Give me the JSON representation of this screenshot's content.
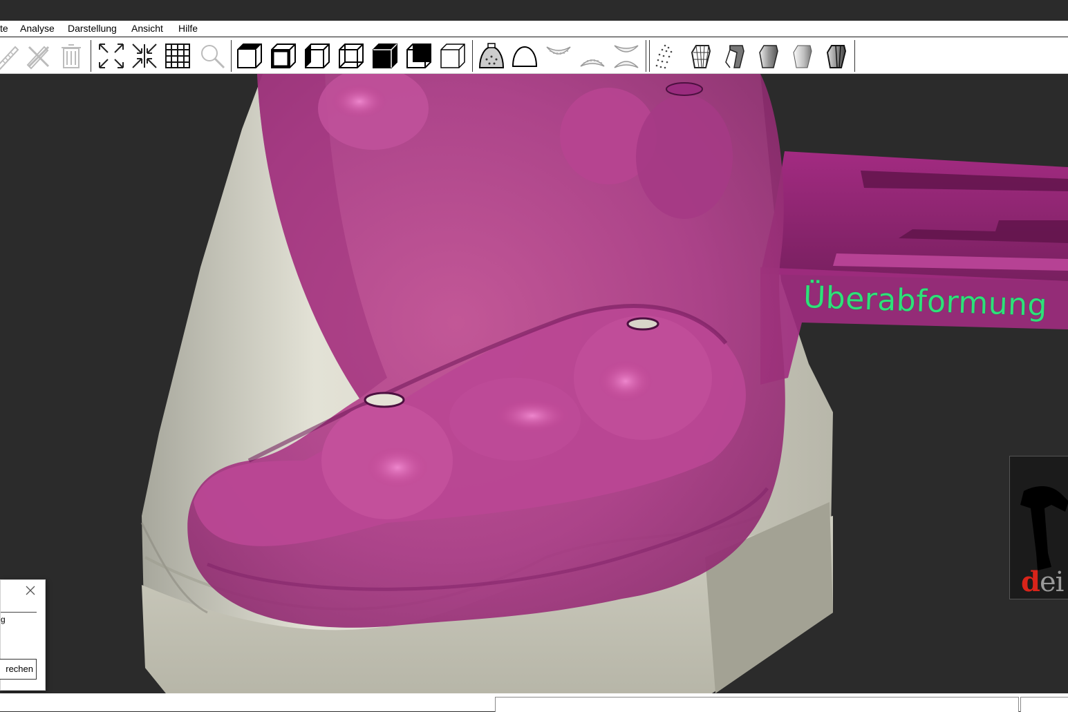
{
  "menubar": {
    "items": [
      "te",
      "Analyse",
      "Darstellung",
      "Ansicht",
      "Hilfe"
    ]
  },
  "toolbar": {
    "groups": [
      [
        "ruler-icon",
        "ruler-erase-icon",
        "trash-icon"
      ],
      [
        "zoom-extents-icon",
        "zoom-fit-icon",
        "grid-icon",
        "magnifier-icon"
      ],
      [
        "view-top-icon",
        "view-front-icon",
        "view-left-icon",
        "view-right-icon",
        "view-bottom-icon",
        "view-back-icon",
        "view-iso-icon"
      ],
      [
        "impression-icon",
        "arch-icon",
        "upper-jaw-icon",
        "lower-jaw-icon",
        "both-jaws-icon"
      ],
      [
        "points-icon",
        "stump-wire-icon",
        "stump-partial-icon",
        "stump-shaded-icon",
        "stump-solid-icon",
        "stump-mixed-icon"
      ]
    ]
  },
  "viewport": {
    "label": "Überabformung",
    "label_color": "#2fe07a",
    "model_color": "#d9d8cc",
    "tray_color": "#b0367f"
  },
  "logo": {
    "text_red": "d",
    "text_rest": "ei e"
  },
  "dialog": {
    "fragment": "g",
    "button_label": "rechen"
  }
}
